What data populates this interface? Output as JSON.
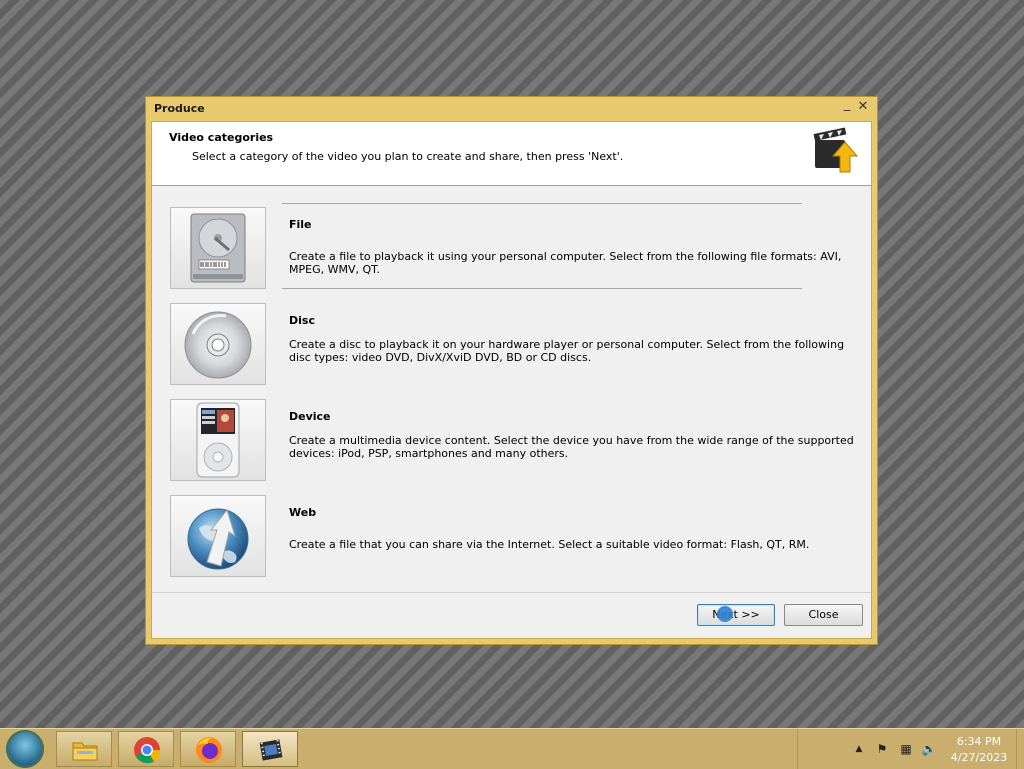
{
  "dialog": {
    "title": "Produce",
    "minimize_icon": "minimize-icon",
    "close_icon": "close-icon",
    "header": {
      "title": "Video categories",
      "subtitle": "Select a category of the video you plan to create and share, then press 'Next'."
    },
    "categories": [
      {
        "title": "File",
        "description": "Create a file to playback it using your personal computer. Select from the following file formats: AVI, MPEG, WMV, QT.",
        "icon": "hard-drive-icon"
      },
      {
        "title": "Disc",
        "description": "Create a disc to playback it on your hardware player or personal computer. Select from the following disc types: video DVD, DivX/XviD DVD, BD or CD discs.",
        "icon": "disc-icon"
      },
      {
        "title": "Device",
        "description": "Create a multimedia device content. Select the device you have from the wide range of the supported devices: iPod, PSP, smartphones and many others.",
        "icon": "media-player-icon"
      },
      {
        "title": "Web",
        "description": "Create a file that you can share via the Internet. Select a suitable video format: Flash, QT, RM.",
        "icon": "globe-icon"
      }
    ],
    "next_label": "Next >>",
    "close_label": "Close"
  },
  "taskbar": {
    "apps": [
      {
        "name": "file-explorer",
        "icon": "folder-icon"
      },
      {
        "name": "chrome",
        "icon": "chrome-icon"
      },
      {
        "name": "firefox",
        "icon": "firefox-icon"
      },
      {
        "name": "video-editor",
        "icon": "film-icon",
        "active": true
      }
    ],
    "time": "6:34 PM",
    "date": "4/27/2023"
  },
  "colors": {
    "dialog_frame": "#e9c96d",
    "taskbar": "#c9ae6e",
    "next_focus": "#3c7fb1"
  }
}
